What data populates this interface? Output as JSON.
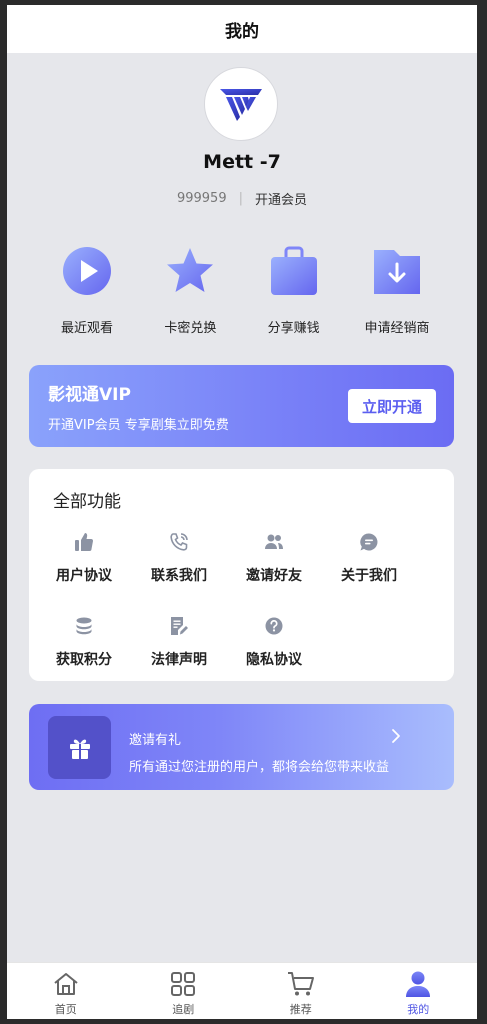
{
  "header": {
    "title": "我的"
  },
  "profile": {
    "name": "Mett -7",
    "uid": "999959",
    "separator": "|",
    "vip_link": "开通会员"
  },
  "quick_actions": [
    {
      "label": "最近观看",
      "icon": "play-icon"
    },
    {
      "label": "卡密兑换",
      "icon": "star-icon"
    },
    {
      "label": "分享赚钱",
      "icon": "bag-icon"
    },
    {
      "label": "申请经销商",
      "icon": "folder-download-icon"
    }
  ],
  "vip_banner": {
    "title": "影视通VIP",
    "subtitle": "开通VIP会员 专享剧集立即免费",
    "button": "立即开通"
  },
  "features": {
    "title": "全部功能",
    "items": [
      {
        "label": "用户协议",
        "icon": "thumbs-up-icon"
      },
      {
        "label": "联系我们",
        "icon": "phone-icon"
      },
      {
        "label": "邀请好友",
        "icon": "users-icon"
      },
      {
        "label": "关于我们",
        "icon": "chat-icon"
      },
      {
        "label": "获取积分",
        "icon": "coins-icon"
      },
      {
        "label": "法律声明",
        "icon": "document-edit-icon"
      },
      {
        "label": "隐私协议",
        "icon": "question-icon"
      }
    ]
  },
  "invite": {
    "title": "邀请有礼",
    "subtitle": "所有通过您注册的用户，都将会给您带来收益"
  },
  "tabbar": {
    "tabs": [
      {
        "label": "首页",
        "icon": "home-icon"
      },
      {
        "label": "追剧",
        "icon": "grid-icon"
      },
      {
        "label": "推荐",
        "icon": "cart-icon"
      },
      {
        "label": "我的",
        "icon": "user-icon",
        "active": true
      }
    ]
  },
  "colors": {
    "accent": "#5b5ef0",
    "background": "#e6e7eb",
    "icon_gradient_start": "#9ab0fd",
    "icon_gradient_end": "#6566ef"
  }
}
